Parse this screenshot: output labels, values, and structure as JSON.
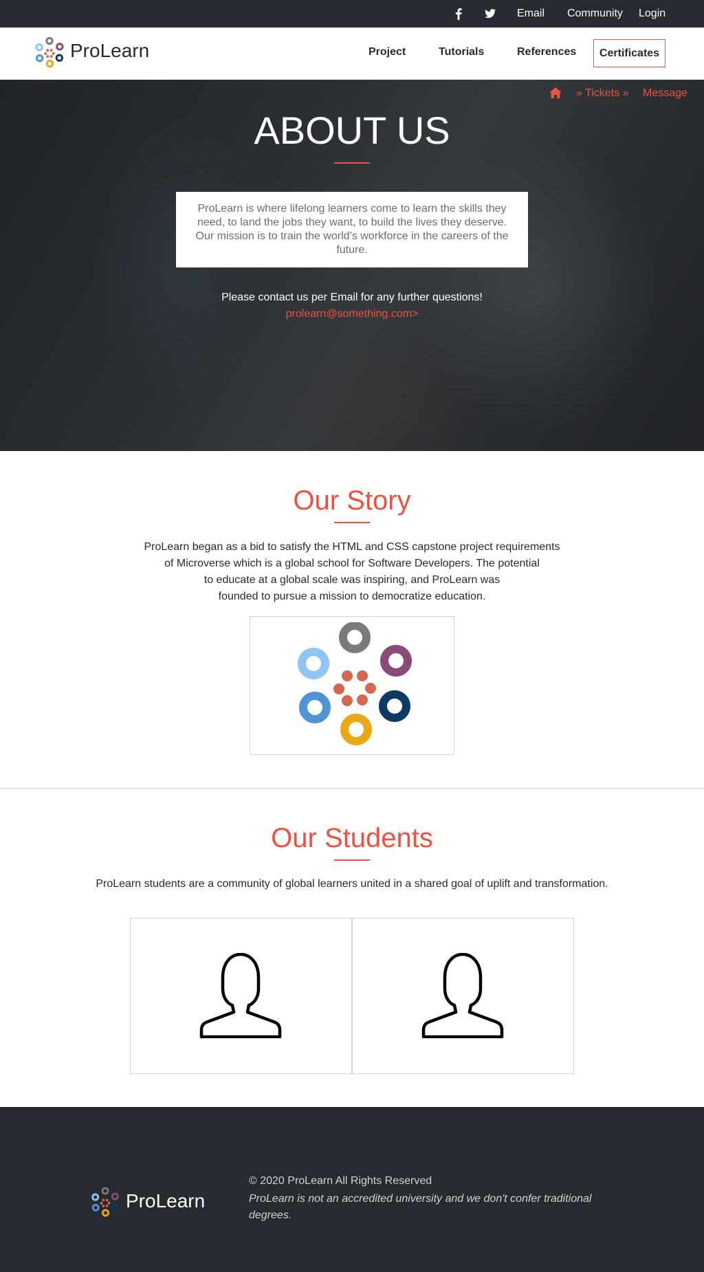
{
  "topbar": {
    "social_icons": [
      "facebook-icon",
      "twitter-icon"
    ],
    "links": [
      "Email",
      "Community",
      "Login"
    ]
  },
  "header": {
    "brand": "ProLearn",
    "nav": [
      "Project",
      "Tutorials",
      "References"
    ],
    "nav_highlight": "Certificates"
  },
  "hero": {
    "breadcrumb_icon": "home-icon",
    "breadcrumb": [
      "» Tickets »",
      "Message"
    ],
    "title": "ABOUT US",
    "description": "ProLearn is where lifelong learners come to learn the skills they need, to land the jobs they want, to build the lives they deserve. Our mission is to train the world’s workforce in the careers of the future.",
    "contact": "Please contact us per Email for any further questions!",
    "email": "prolearn@something.com>"
  },
  "story": {
    "title": "Our Story",
    "lines": [
      "ProLearn began as a bid to satisfy the HTML and CSS capstone project requirements",
      "of Microverse which is a global school for Software Developers. The potential",
      "to educate at a global scale was inspiring, and ProLearn was",
      "founded to pursue a mission to democratize education."
    ]
  },
  "students": {
    "title": "Our Students",
    "text": "ProLearn students are a community of global learners united in a shared goal of uplift and transformation.",
    "cards": [
      "user-icon",
      "user-icon"
    ]
  },
  "footer": {
    "brand": "ProLearn",
    "copyright": "© 2020 ProLearn All Rights Reserved",
    "note": "ProLearn is not an accredited university and we don't confer traditional degrees."
  },
  "colors": {
    "accent": "#ec5242",
    "dark": "#272a31",
    "logo_gray": "#7a7a7a",
    "logo_purple": "#8a4a77",
    "logo_lightblue": "#8ec5f2",
    "logo_blue": "#4f94d4",
    "logo_navy": "#0f3a66",
    "logo_yellow": "#eaa816",
    "logo_dots": "#d5664f"
  }
}
